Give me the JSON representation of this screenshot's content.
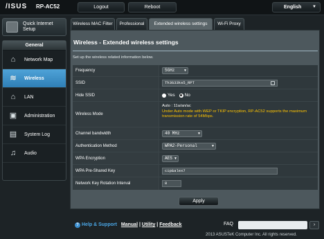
{
  "header": {
    "logo": "/ISUS",
    "model": "RP-AC52",
    "logout": "Logout",
    "reboot": "Reboot",
    "language": "English"
  },
  "sidebar": {
    "quick_setup": "Quick Internet Setup",
    "section": "General",
    "items": [
      {
        "label": "Network Map",
        "icon": "network-map-icon"
      },
      {
        "label": "Wireless",
        "icon": "wireless-icon",
        "active": true
      },
      {
        "label": "LAN",
        "icon": "home-icon"
      },
      {
        "label": "Administration",
        "icon": "administration-icon"
      },
      {
        "label": "System Log",
        "icon": "system-log-icon"
      },
      {
        "label": "Audio",
        "icon": "audio-icon"
      }
    ]
  },
  "tabs": [
    "Wireless MAC Filter",
    "Professional",
    "Extended wireless settings",
    "Wi-Fi Proxy"
  ],
  "panel": {
    "title": "Wireless - Extended wireless settings",
    "description": "Set up the wireless related information below.",
    "fields": {
      "frequency": {
        "label": "Frequency",
        "value": "5GHz"
      },
      "ssid": {
        "label": "SSID",
        "value": "Th3G33ks5_RPT"
      },
      "hide_ssid": {
        "label": "Hide SSID",
        "yes": "Yes",
        "no": "No",
        "selected": "No"
      },
      "wireless_mode": {
        "label": "Wireless Mode",
        "value": "Auto : 11a/an/ac",
        "note": "Under Auto mode with WEP or TKIP encryption, RP-AC52 supports the maximum transmission rate of 54Mbps."
      },
      "channel_bandwidth": {
        "label": "Channel bandwidth",
        "value": "40 MHz"
      },
      "auth_method": {
        "label": "Authentication Method",
        "value": "WPA2-Personal"
      },
      "wpa_encryption": {
        "label": "WPA Encryption",
        "value": "AES"
      },
      "psk": {
        "label": "WPA Pre-Shared Key",
        "value": "cip&alex7"
      },
      "rotation": {
        "label": "Network Key Rotation Interval",
        "value": "0"
      }
    },
    "apply": "Apply"
  },
  "footer": {
    "help": "Help & Support",
    "manual": "Manual",
    "utility": "Utility",
    "feedback": "Feedback",
    "faq": "FAQ",
    "copyright": "2013 ASUSTeK Computer Inc. All rights reserved."
  },
  "colors": {
    "accent": "#2f7fb6",
    "warning": "#ffc400",
    "background": "#1d2326"
  }
}
